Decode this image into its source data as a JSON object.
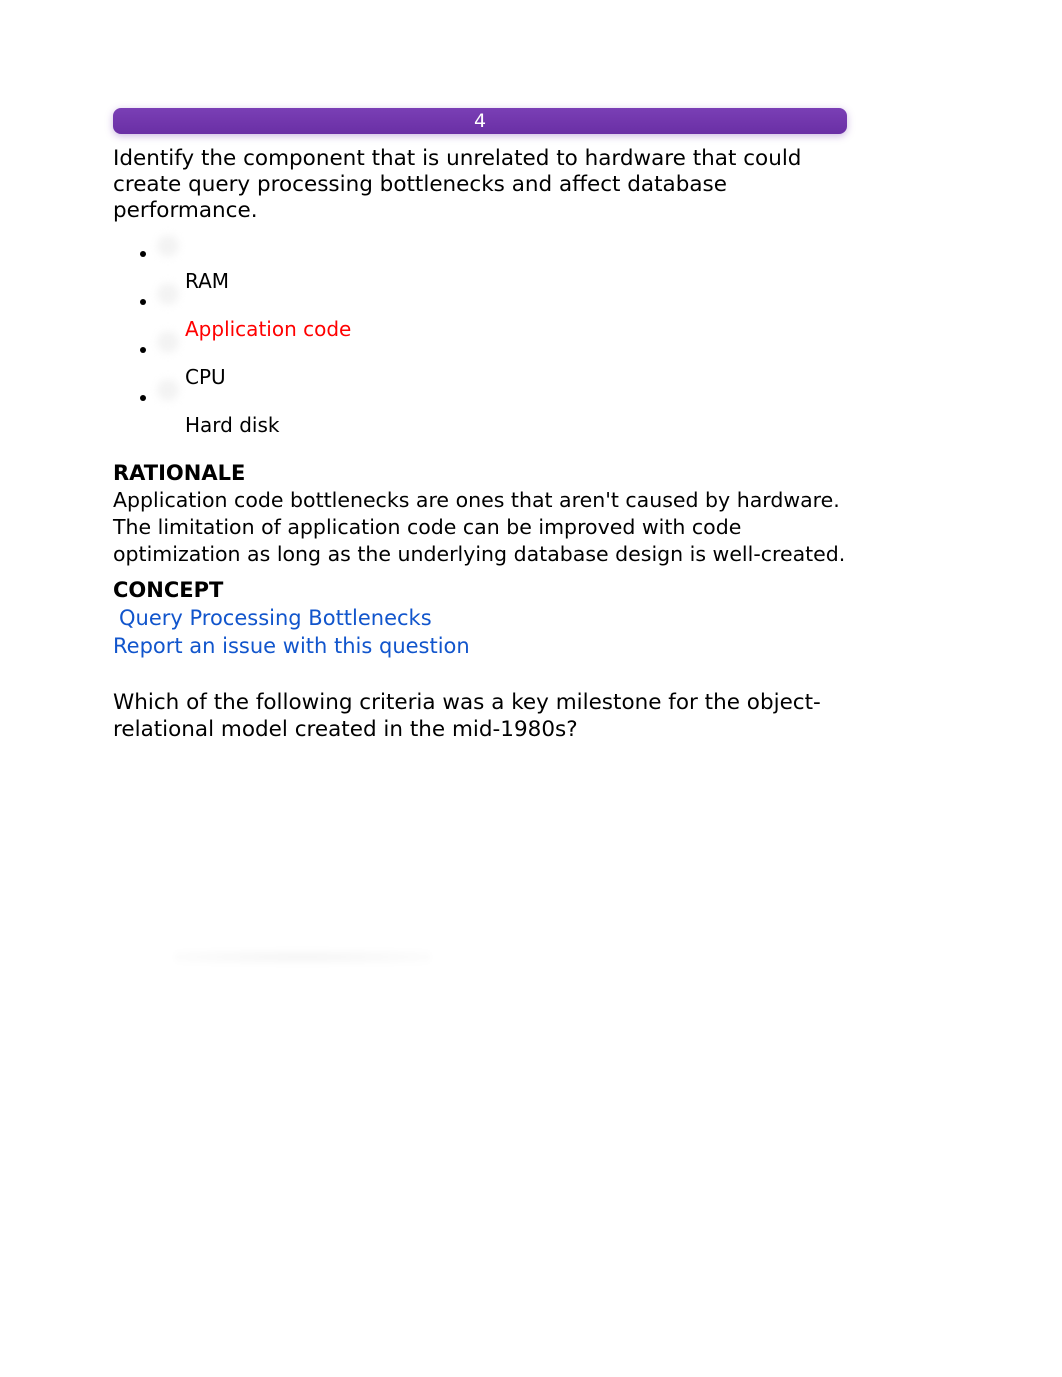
{
  "question_number": "4",
  "question_1": {
    "prompt": "Identify the component that is unrelated to hardware that could create query processing bottlenecks and affect database performance.",
    "answers": [
      {
        "label": "RAM",
        "highlighted": false
      },
      {
        "label": "Application code",
        "highlighted": true
      },
      {
        "label": "CPU",
        "highlighted": false
      },
      {
        "label": "Hard disk",
        "highlighted": false
      }
    ],
    "rationale_head": "RATIONALE",
    "rationale_text": "Application code bottlenecks are ones that aren't caused by hardware. The limitation of application code can be improved with code optimization as long as the underlying database design is well-created.",
    "concept_head": "CONCEPT",
    "concept_link": "Query Processing Bottlenecks",
    "report_link": "Report an issue with this question"
  },
  "question_2": {
    "prompt": "Which of the following criteria was a key milestone for the object-relational model created in the mid-1980s?"
  }
}
